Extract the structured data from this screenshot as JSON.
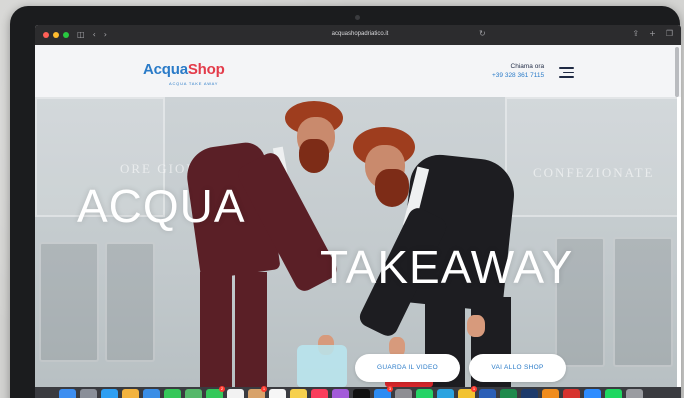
{
  "browser": {
    "url": "acquashopadriatico.it",
    "back_glyph": "‹",
    "forward_glyph": "›",
    "sidebar_glyph": "◫",
    "reload_glyph": "↻",
    "share_glyph": "⇪",
    "newtab_glyph": "+",
    "tabs_glyph": "❐"
  },
  "header": {
    "logo": {
      "word_part1": "Acqua",
      "word_part2": "Shop",
      "tagline": "ACQUA TAKE AWAY",
      "colors": {
        "blue": "#2a7bc8",
        "red": "#e33b4a"
      }
    },
    "call_label": "Chiama ora",
    "phone": "+39 328 361 7115",
    "menu_icon": "hamburger-menu-icon"
  },
  "hero": {
    "title_line1": "ACQUA",
    "title_line2": "TAKEAWAY",
    "sign_left": "ORE  GIORNI",
    "sign_right": "CONFEZIONATE",
    "buttons": {
      "video": "GUARDA IL VIDEO",
      "shop": "VAI ALLO SHOP"
    }
  },
  "dock": {
    "apps": [
      {
        "name": "finder-icon",
        "color": "#3d8ef0"
      },
      {
        "name": "launchpad-icon",
        "color": "#8a8f99"
      },
      {
        "name": "safari-icon",
        "color": "#2f9ff2"
      },
      {
        "name": "photos-icon",
        "color": "#f3b33e"
      },
      {
        "name": "mail-icon",
        "color": "#3a8ee6"
      },
      {
        "name": "messages-icon",
        "color": "#35c759"
      },
      {
        "name": "maps-icon",
        "color": "#55b86a"
      },
      {
        "name": "facetime-icon",
        "color": "#34c85a",
        "badge": "2"
      },
      {
        "name": "calendar-icon",
        "color": "#f2f2f2"
      },
      {
        "name": "contacts-icon",
        "color": "#d8a26a",
        "badge": "1"
      },
      {
        "name": "reminders-icon",
        "color": "#f6f6f6"
      },
      {
        "name": "notes-icon",
        "color": "#f6d04d"
      },
      {
        "name": "music-icon",
        "color": "#fa3d5c"
      },
      {
        "name": "podcasts-icon",
        "color": "#a35bd9"
      },
      {
        "name": "tv-icon",
        "color": "#111111"
      },
      {
        "name": "appstore-icon",
        "color": "#2d8cf3",
        "badge": "3"
      },
      {
        "name": "settings-icon",
        "color": "#8e8e93"
      },
      {
        "name": "whatsapp-icon",
        "color": "#25d366"
      },
      {
        "name": "telegram-icon",
        "color": "#2aa3e0"
      },
      {
        "name": "chrome-icon",
        "color": "#f2c230",
        "badge": "1"
      },
      {
        "name": "word-icon",
        "color": "#2b5fb7"
      },
      {
        "name": "excel-icon",
        "color": "#1e8a4c"
      },
      {
        "name": "photoshop-icon",
        "color": "#1c3a6b"
      },
      {
        "name": "illustrator-icon",
        "color": "#f08c1d"
      },
      {
        "name": "acrobat-icon",
        "color": "#d7332f"
      },
      {
        "name": "zoom-icon",
        "color": "#2d8cff"
      },
      {
        "name": "spotify-icon",
        "color": "#1ed760"
      },
      {
        "name": "trash-icon",
        "color": "#9a9ca1"
      }
    ]
  }
}
